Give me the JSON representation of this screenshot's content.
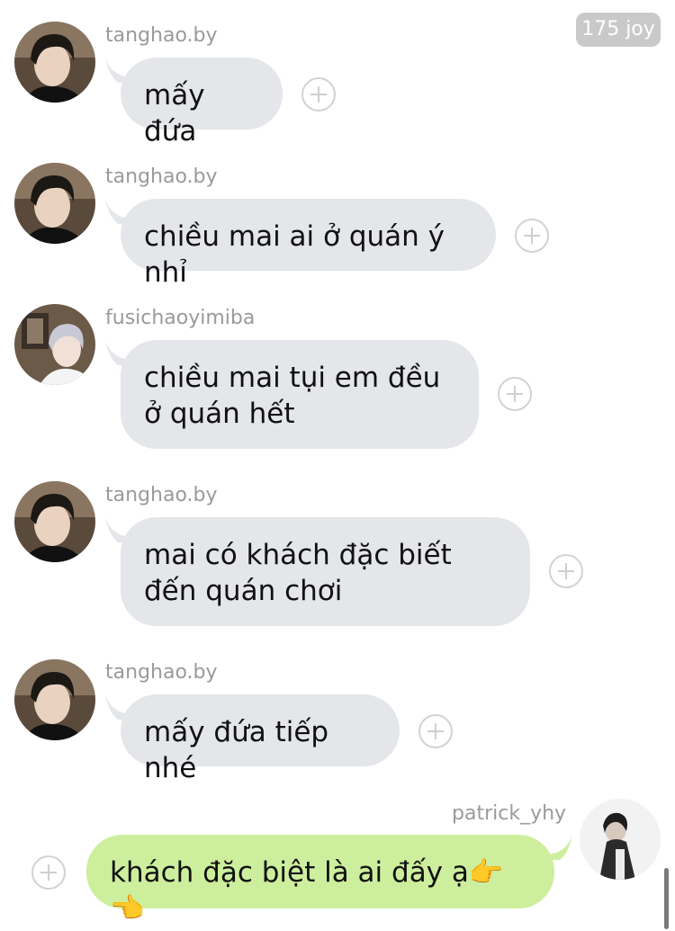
{
  "header": {
    "joy_badge": "175 joy"
  },
  "messages": [
    {
      "sender": "tanghao.by",
      "text": "mấy đứa"
    },
    {
      "sender": "tanghao.by",
      "text": "chiều mai ai ở quán ý nhỉ"
    },
    {
      "sender": "fusichaoyimiba",
      "text": "chiều mai tụi em đều ở quán hết"
    },
    {
      "sender": "tanghao.by",
      "text": "mai có khách đặc biết đến quán chơi"
    },
    {
      "sender": "tanghao.by",
      "text": "mấy đứa tiếp nhé"
    },
    {
      "sender": "patrick_yhy",
      "text": "khách đặc biệt là ai đấy ạ👉👈"
    }
  ],
  "colors": {
    "incoming_bubble": "#e4e6ea",
    "outgoing_bubble": "#cdef9d",
    "sender_name": "#9a9a9a",
    "badge": "#c9c9c9"
  },
  "icons": [
    "plus-circle-icon"
  ]
}
